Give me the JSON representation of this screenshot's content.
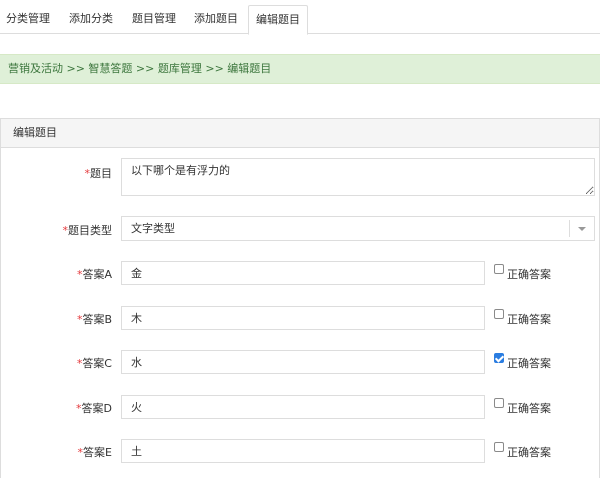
{
  "tabs": [
    {
      "label": "分类管理"
    },
    {
      "label": "添加分类"
    },
    {
      "label": "题目管理"
    },
    {
      "label": "添加题目"
    },
    {
      "label": "编辑题目",
      "active": true
    }
  ],
  "breadcrumb": "营销及活动 >> 智慧答题 >> 题库管理 >> 编辑题目",
  "panel": {
    "title": "编辑题目"
  },
  "form": {
    "required_mark": "*",
    "question": {
      "label": "题目",
      "value": "以下哪个是有浮力的"
    },
    "type": {
      "label": "题目类型",
      "value": "文字类型"
    },
    "correct_label": "正确答案",
    "answers": [
      {
        "label": "答案A",
        "value": "金",
        "correct": false
      },
      {
        "label": "答案B",
        "value": "木",
        "correct": false
      },
      {
        "label": "答案C",
        "value": "水",
        "correct": true
      },
      {
        "label": "答案D",
        "value": "火",
        "correct": false
      },
      {
        "label": "答案E",
        "value": "土",
        "correct": false
      }
    ]
  },
  "colors": {
    "breadcrumb_bg": "#dff0d8",
    "breadcrumb_text": "#3c763d",
    "required": "#e4393c",
    "checkbox_checked": "#2a7de1"
  }
}
